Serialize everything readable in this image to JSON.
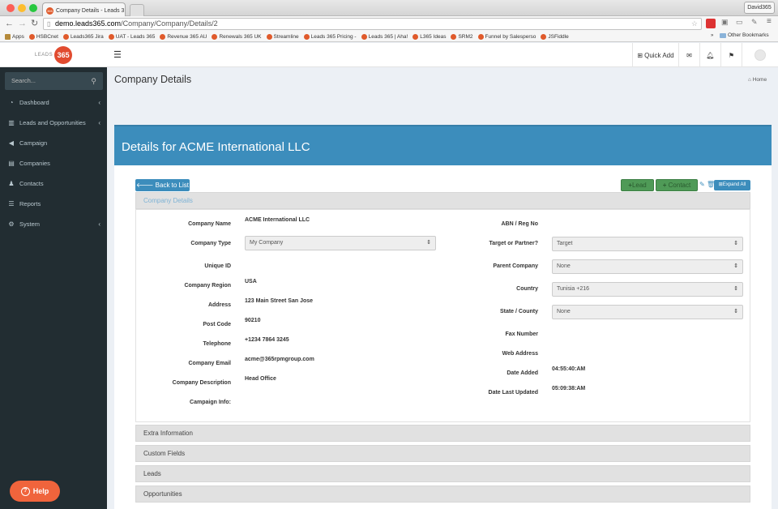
{
  "browser": {
    "tab_title": "Company Details - Leads 3",
    "user": "David365",
    "url_host": "demo.leads365.com",
    "url_path": "/Company/Company/Details/2",
    "bookmarks": [
      "Apps",
      "HSBCnet",
      "Leads365 Jira",
      "UAT - Leads 365",
      "Revenue 365 AU",
      "Renewals 365 UK",
      "Streamline",
      "Leads 365 Pricing -",
      "Leads 365 | Aha!",
      "L365 Ideas",
      "SRM2",
      "Funnel by Salesperso",
      "JSFiddle"
    ],
    "other_bookmarks": "Other Bookmarks"
  },
  "header": {
    "logo_text": "LEADS",
    "logo_number": "365",
    "quick_add": "Quick Add"
  },
  "sidebar": {
    "search_placeholder": "Search...",
    "items": [
      {
        "label": "Dashboard",
        "icon": "dashboard-icon",
        "has_children": true
      },
      {
        "label": "Leads and Opportunities",
        "icon": "bar-chart-icon",
        "has_children": true
      },
      {
        "label": "Campaign",
        "icon": "megaphone-icon",
        "has_children": false
      },
      {
        "label": "Companies",
        "icon": "building-icon",
        "has_children": false
      },
      {
        "label": "Contacts",
        "icon": "users-icon",
        "has_children": false
      },
      {
        "label": "Reports",
        "icon": "list-icon",
        "has_children": false
      },
      {
        "label": "System",
        "icon": "cogs-icon",
        "has_children": true
      }
    ],
    "help": "Help"
  },
  "page": {
    "title": "Company Details",
    "breadcrumb": "Home",
    "box_title": "Details for ACME International LLC",
    "back_button": "Back to List",
    "lead_button": "Lead",
    "contact_button": "Contact",
    "expand_all": "Expand All",
    "section_title": "Company Details"
  },
  "details_left": [
    {
      "label": "Company Name",
      "value": "ACME International LLC"
    },
    {
      "label": "Company Type",
      "value": "My Company",
      "type": "select"
    },
    {
      "label": "Unique ID",
      "value": ""
    },
    {
      "label": "Company Region",
      "value": "USA"
    },
    {
      "label": "Address",
      "value": "123 Main Street San Jose"
    },
    {
      "label": "Post Code",
      "value": "90210"
    },
    {
      "label": "Telephone",
      "value": "+1234 7864 3245"
    },
    {
      "label": "Company Email",
      "value": "acme@365rpmgroup.com"
    },
    {
      "label": "Company Description",
      "value": "Head Office"
    },
    {
      "label": "Campaign Info:",
      "value": ""
    }
  ],
  "details_right": [
    {
      "label": "ABN / Reg No",
      "value": ""
    },
    {
      "label": "Target or Partner?",
      "value": "Target",
      "type": "select"
    },
    {
      "label": "Parent Company",
      "value": "None",
      "type": "select"
    },
    {
      "label": "Country",
      "value": "Tunisia +216",
      "type": "select"
    },
    {
      "label": "State / County",
      "value": "None",
      "type": "select"
    },
    {
      "label": "Fax Number",
      "value": ""
    },
    {
      "label": "Web Address",
      "value": ""
    },
    {
      "label": "Date Added",
      "value": "04:55:40:AM"
    },
    {
      "label": "Date Last Updated",
      "value": "05:09:38:AM"
    }
  ],
  "collapsed_sections": [
    "Extra Information",
    "Custom Fields",
    "Leads",
    "Opportunities"
  ],
  "colors": {
    "primary": "#3c8dbc",
    "sidebar": "#222d32",
    "success": "#4f9a57",
    "help": "#f0643c"
  }
}
